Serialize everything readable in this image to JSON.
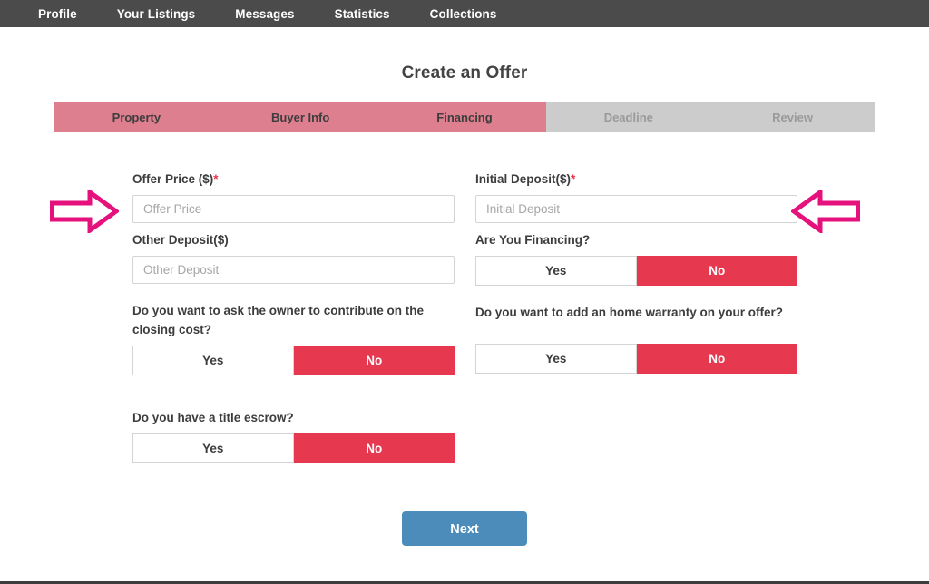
{
  "nav": {
    "items": [
      {
        "label": "Profile"
      },
      {
        "label": "Your Listings"
      },
      {
        "label": "Messages"
      },
      {
        "label": "Statistics"
      },
      {
        "label": "Collections"
      }
    ]
  },
  "page": {
    "title": "Create an Offer"
  },
  "steps": [
    {
      "label": "Property",
      "state": "active"
    },
    {
      "label": "Buyer Info",
      "state": "active"
    },
    {
      "label": "Financing",
      "state": "active"
    },
    {
      "label": "Deadline",
      "state": "inactive"
    },
    {
      "label": "Review",
      "state": "inactive"
    }
  ],
  "form": {
    "offer_price": {
      "label": "Offer Price ($)",
      "required_marker": "*",
      "placeholder": "Offer Price",
      "value": ""
    },
    "initial_deposit": {
      "label": "Initial Deposit($)",
      "required_marker": "*",
      "placeholder": "Initial Deposit",
      "value": ""
    },
    "other_deposit": {
      "label": "Other Deposit($)",
      "placeholder": "Other Deposit",
      "value": ""
    },
    "financing": {
      "label": "Are You Financing?",
      "yes_label": "Yes",
      "no_label": "No",
      "selected": "No"
    },
    "closing_cost": {
      "label": "Do you want to ask the owner to contribute on the closing cost?",
      "yes_label": "Yes",
      "no_label": "No",
      "selected": "No"
    },
    "home_warranty": {
      "label": "Do you want to add an home warranty on your offer?",
      "yes_label": "Yes",
      "no_label": "No",
      "selected": "No"
    },
    "title_escrow": {
      "label": "Do you have a title escrow?",
      "yes_label": "Yes",
      "no_label": "No",
      "selected": "No"
    }
  },
  "footer": {
    "next_label": "Next"
  },
  "annotations": {
    "left_arrow": "right-arrow-annotation",
    "right_arrow": "left-arrow-annotation",
    "arrow_color": "#e5117c"
  },
  "colors": {
    "nav_bg": "#4b4b4b",
    "step_active": "#dd7f8e",
    "step_inactive": "#cccccc",
    "toggle_selected": "#e63950",
    "next_button": "#4b8cbb",
    "required_asterisk": "#e8334a"
  }
}
